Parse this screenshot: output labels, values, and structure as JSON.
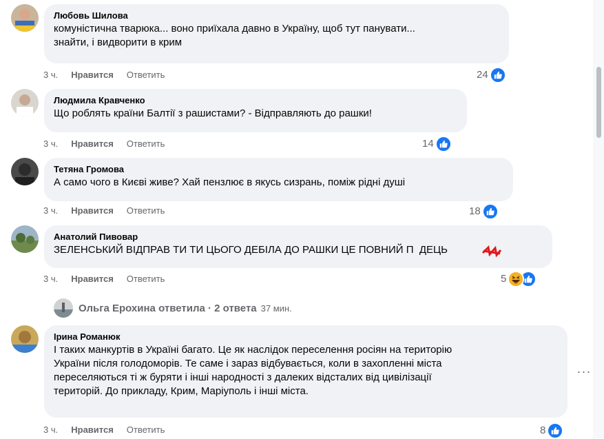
{
  "comments": [
    {
      "author": "Любовь Шилова",
      "text": "комуністична тварюка... воно приїхала давно в Україну, щоб тут панувати...\nзнайти, і видворити в крим",
      "time": "3 ч.",
      "like_label": "Нравится",
      "reply_label": "Ответить",
      "reaction_count": "24",
      "reaction": "like-icon"
    },
    {
      "author": "Людмила Кравченко",
      "text": "Що роблять країни Балтії з рашистами? - Відправляють до рашки!",
      "time": "3 ч.",
      "like_label": "Нравится",
      "reply_label": "Ответить",
      "reaction_count": "14",
      "reaction": "like-icon"
    },
    {
      "author": "Тетяна Громова",
      "text": "А само чого в Києві живе? Хай пензлює в якусь сизрань, поміж рідні душі",
      "time": "3 ч.",
      "like_label": "Нравится",
      "reply_label": "Ответить",
      "reaction_count": "18",
      "reaction": "like-icon"
    },
    {
      "author": "Анатолий Пивовар",
      "text": "ЗЕЛЕНСЬКИЙ ВІДПРАВ ТИ ТИ ЦЬОГО ДЕБІЛА ДО РАШКИ ЦЕ ПОВНИЙ П  ДЕЦЬ",
      "time": "3 ч.",
      "like_label": "Нравится",
      "reply_label": "Ответить",
      "reaction_count": "5",
      "reaction": "haha-icon, like-icon"
    },
    {
      "author": "Ірина Романюк",
      "text": "І таких манкуртів в Україні багато. Це як наслідок переселення росіян на територію\nУкраїни після голодоморів. Те саме і зараз відбувається, коли в захопленні міста\nпереселяються ті ж буряти і інші народності з далеких відсталих від цивілізації\nтериторій. До прикладу, Крим, Маріуполь і інші міста.",
      "time": "3 ч.",
      "like_label": "Нравится",
      "reply_label": "Ответить",
      "reaction_count": "8",
      "reaction": "like-icon"
    }
  ],
  "reply_thread": {
    "text": "Ольга Ерохина ответила · 2 ответа",
    "time": "37 мин."
  },
  "more_button": "···",
  "colors": {
    "bubble": "#f0f2f5",
    "meta": "#65676b",
    "like_blue": "#1877f2",
    "haha_yellow": "#f7b125",
    "text": "#050505"
  }
}
